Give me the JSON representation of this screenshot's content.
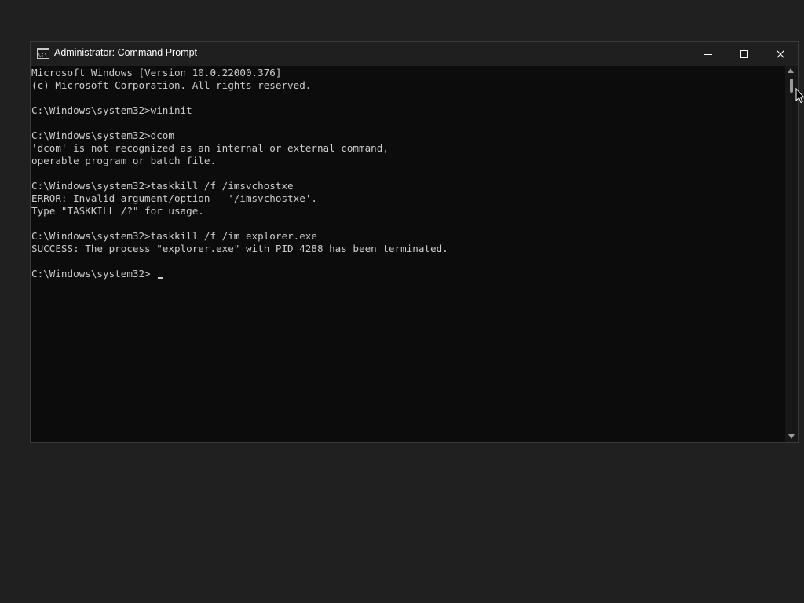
{
  "window": {
    "title": "Administrator: Command Prompt",
    "icon": "cmd-icon",
    "controls": {
      "minimize_icon": "minimize-icon",
      "maximize_icon": "maximize-icon",
      "close_icon": "close-icon"
    }
  },
  "console": {
    "lines": [
      "Microsoft Windows [Version 10.0.22000.376]",
      "(c) Microsoft Corporation. All rights reserved.",
      "",
      "C:\\Windows\\system32>wininit",
      "",
      "C:\\Windows\\system32>dcom",
      "'dcom' is not recognized as an internal or external command,",
      "operable program or batch file.",
      "",
      "C:\\Windows\\system32>taskkill /f /imsvchostxe",
      "ERROR: Invalid argument/option - '/imsvchostxe'.",
      "Type \"TASKKILL /?\" for usage.",
      "",
      "C:\\Windows\\system32>taskkill /f /im explorer.exe",
      "SUCCESS: The process \"explorer.exe\" with PID 4288 has been terminated.",
      "",
      "C:\\Windows\\system32>"
    ]
  },
  "colors": {
    "console_background": "#0c0c0c",
    "console_text": "#cccccc",
    "titlebar": "#1f1f1f",
    "desktop": "#202020"
  }
}
